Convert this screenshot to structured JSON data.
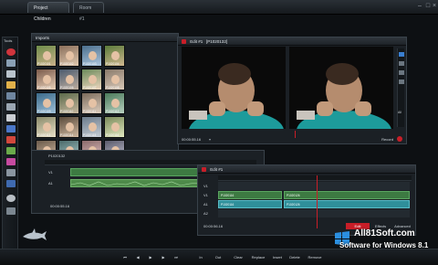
{
  "window": {
    "project_tab": "Project Children",
    "room_tab": "Room #1"
  },
  "tools_panel": {
    "title": "Tools"
  },
  "imports_panel": {
    "title": "Imports",
    "thumbnails": [
      {
        "caption": "P1020101"
      },
      {
        "caption": "P1020102"
      },
      {
        "caption": "P1020103"
      },
      {
        "caption": "P1020104"
      },
      {
        "caption": "P1020105"
      },
      {
        "caption": "P1020106"
      },
      {
        "caption": "P1020107"
      },
      {
        "caption": "P1020108"
      },
      {
        "caption": "P1020109"
      },
      {
        "caption": "P1020110"
      },
      {
        "caption": "P1020111"
      },
      {
        "caption": "P1020112"
      },
      {
        "caption": "P1020113"
      },
      {
        "caption": "P1020114"
      },
      {
        "caption": "P1020115"
      },
      {
        "caption": "P1020116"
      },
      {
        "caption": "P1020117"
      },
      {
        "caption": "P1020118"
      },
      {
        "caption": "P1020119"
      },
      {
        "caption": "P1020120"
      }
    ]
  },
  "viewer_panel": {
    "title": "Edit #1",
    "clip": "P1020132",
    "timecode": "00:00:55.16",
    "record_label": "Record",
    "side_label": "All"
  },
  "source_timeline": {
    "clip": "P1020132",
    "timecode": "00:00:55.16",
    "tracks": [
      "V1",
      "A1"
    ]
  },
  "edit_panel": {
    "title": "Edit #1",
    "tracks": [
      "V1",
      "V1",
      "A1",
      "A2"
    ],
    "clip_labels": [
      "P1020116",
      "P1020126",
      "P1020116",
      "P1020126"
    ],
    "timecode": "00:00:56.16",
    "tabs": [
      "Edit",
      "Effects",
      "Advanced"
    ]
  },
  "bottom_toolbar": {
    "buttons": [
      "In",
      "Out",
      "Clear",
      "Replace",
      "Insert",
      "Delete",
      "Remove"
    ]
  },
  "watermark": {
    "line1": "All81Soft.com",
    "line2": "Software for Windows 8.1"
  },
  "colors": {
    "accent": "#c81e28",
    "panel_bg": "#1b2025",
    "timeline_green": "#4e8a4a",
    "timeline_teal": "#2f8f9a"
  }
}
